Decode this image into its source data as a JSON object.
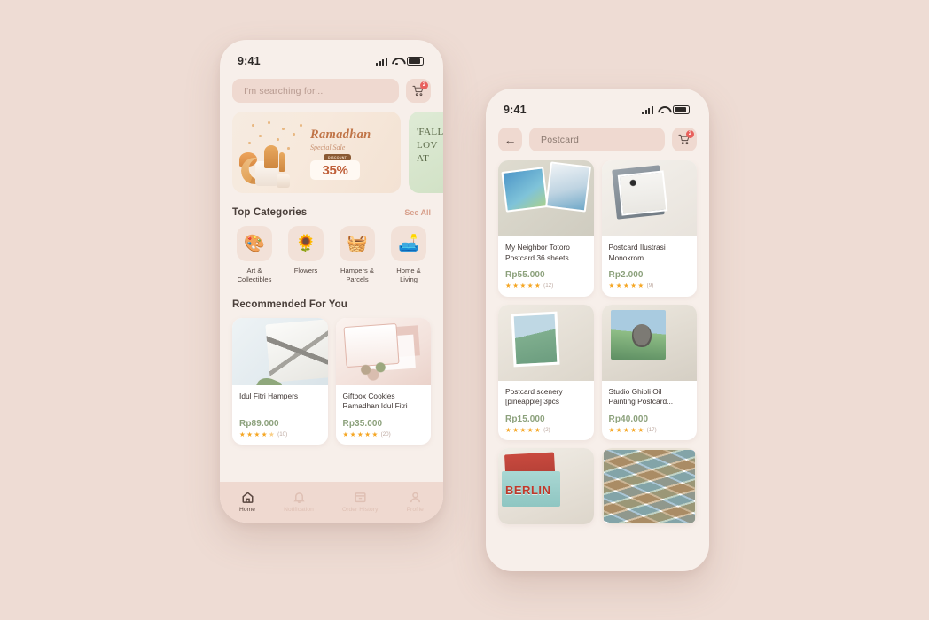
{
  "canvas": {
    "background_color": "#EEDCD4"
  },
  "phone_home": {
    "status": {
      "time": "9:41",
      "signal_icon": "cellular-signal-icon",
      "wifi_icon": "wifi-icon",
      "battery_icon": "battery-icon"
    },
    "search": {
      "placeholder": "I'm searching for...",
      "value": ""
    },
    "cart": {
      "icon": "shopping-cart-icon",
      "badge": "2"
    },
    "banners": [
      {
        "title": "Ramadhan",
        "subtitle": "Special Sale",
        "pill": "DISCOUNT",
        "discount": "35%"
      },
      {
        "text": "'FALL\nLOV\nAT"
      }
    ],
    "categories_section": {
      "title": "Top Categories",
      "link": "See All"
    },
    "categories": [
      {
        "label": "Art &\nCollectibles",
        "icon": "art-palette-icon",
        "glyph": "🎨"
      },
      {
        "label": "Flowers",
        "icon": "sunflower-icon",
        "glyph": "🌻"
      },
      {
        "label": "Hampers &\nParcels",
        "icon": "gift-basket-icon",
        "glyph": "🧺"
      },
      {
        "label": "Home &\nLiving",
        "icon": "armchair-icon",
        "glyph": "🛋️"
      }
    ],
    "recommended_section": {
      "title": "Recommended For You"
    },
    "recommended": [
      {
        "title": "Idul Fitri Hampers",
        "price": "Rp89.000",
        "rating": 4.5,
        "rating_count": "(10)",
        "image": "hampers-gift-photo"
      },
      {
        "title": "Giftbox Cookies Ramadhan Idul Fitri",
        "price": "Rp35.000",
        "rating": 5,
        "rating_count": "(20)",
        "image": "giftbox-cookies-photo"
      }
    ],
    "bottom_nav": [
      {
        "label": "Home",
        "icon": "home-icon",
        "active": true
      },
      {
        "label": "Notification",
        "icon": "bell-icon",
        "active": false
      },
      {
        "label": "Order History",
        "icon": "archive-box-icon",
        "active": false
      },
      {
        "label": "Profile",
        "icon": "user-icon",
        "active": false
      }
    ]
  },
  "phone_search": {
    "status": {
      "time": "9:41",
      "signal_icon": "cellular-signal-icon",
      "wifi_icon": "wifi-icon",
      "battery_icon": "battery-icon"
    },
    "back": {
      "icon": "back-arrow-icon",
      "glyph": "←"
    },
    "search": {
      "value": "Postcard",
      "placeholder": "I'm searching for..."
    },
    "cart": {
      "icon": "shopping-cart-icon",
      "badge": "2"
    },
    "results": [
      {
        "title": "My Neighbor Totoro Postcard 36 sheets...",
        "price": "Rp55.000",
        "rating": 5,
        "rating_count": "(12)",
        "image": "totoro-postcard-set-photo"
      },
      {
        "title": "Postcard Ilustrasi Monokrom",
        "price": "Rp2.000",
        "rating": 5,
        "rating_count": "(9)",
        "image": "monochrome-postcard-photo"
      },
      {
        "title": "Postcard scenery [pineapple] 3pcs",
        "price": "Rp15.000",
        "rating": 5,
        "rating_count": "(2)",
        "image": "scenery-postcard-photo"
      },
      {
        "title": "Studio Ghibli Oil Painting Postcard...",
        "price": "Rp40.000",
        "rating": 5,
        "rating_count": "(17)",
        "image": "ghibli-totoro-postcard-photo"
      },
      {
        "title": "",
        "price": "",
        "rating": 0,
        "rating_count": "",
        "image": "berlin-greetings-postcard-photo",
        "overlay_text": "BERLIN"
      },
      {
        "title": "",
        "price": "",
        "rating": 0,
        "rating_count": "",
        "image": "vintage-postcard-pile-photo"
      }
    ]
  }
}
